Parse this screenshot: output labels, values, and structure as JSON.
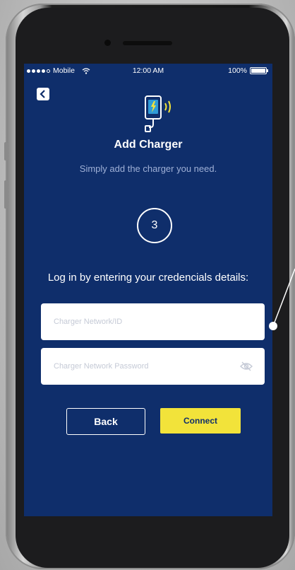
{
  "status_bar": {
    "carrier": "Mobile",
    "time": "12:00 AM",
    "battery": "100%"
  },
  "header": {
    "back_icon": "chevron-left-icon",
    "charger_icon": "charger-wireless-icon",
    "title": "Add Charger",
    "subtitle": "Simply add the charger you need."
  },
  "step": {
    "number": "3"
  },
  "form": {
    "instruction": "Log in by entering your credencials details:",
    "username_placeholder": "Charger Network/ID",
    "password_placeholder": "Charger Network Password"
  },
  "actions": {
    "back_label": "Back",
    "connect_label": "Connect"
  },
  "colors": {
    "background": "#0f2e6b",
    "accent": "#f2e33a"
  }
}
